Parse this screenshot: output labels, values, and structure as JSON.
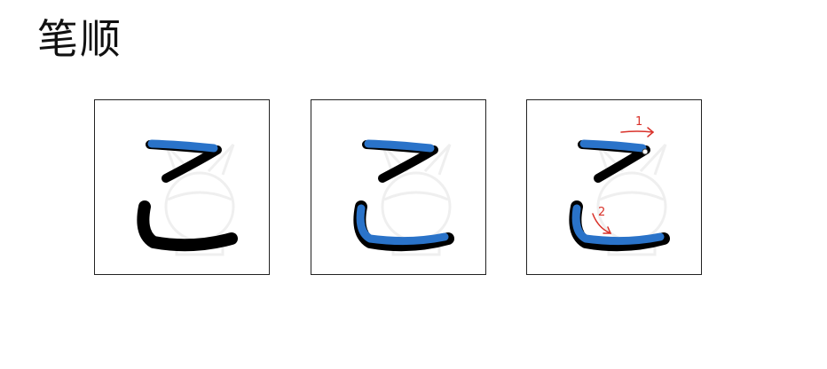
{
  "title": "笔顺",
  "panels": [
    {
      "label": "stroke-1"
    },
    {
      "label": "stroke-2"
    },
    {
      "label": "stroke-order-arrows",
      "arrow_numbers": [
        "1",
        "2"
      ]
    }
  ],
  "colors": {
    "ink": "#000000",
    "highlight": "#2a73c9",
    "arrow": "#d9322a",
    "watermark": "#ececec"
  }
}
